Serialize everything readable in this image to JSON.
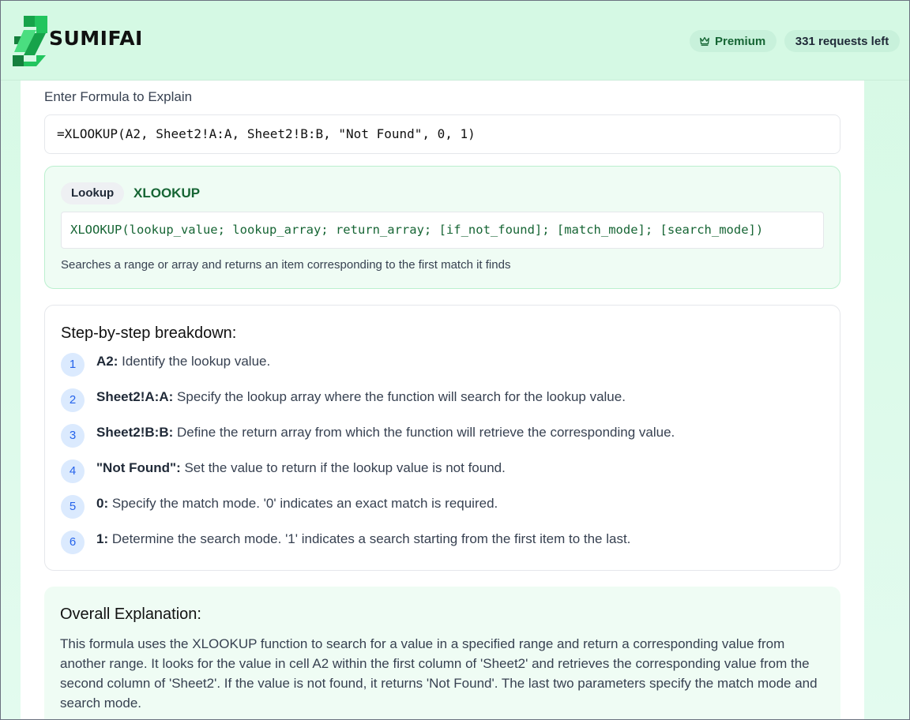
{
  "header": {
    "brand": "SUMIFAI",
    "premium_label": "Premium",
    "requests_label": "331 requests left",
    "colors": {
      "brand_green": "#16a34a",
      "header_bg": "#d5f9e4"
    }
  },
  "formula": {
    "label": "Enter Formula to Explain",
    "value": "=XLOOKUP(A2, Sheet2!A:A, Sheet2!B:B, \"Not Found\", 0, 1)"
  },
  "function_card": {
    "category": "Lookup",
    "name": "XLOOKUP",
    "syntax": "XLOOKUP(lookup_value; lookup_array; return_array; [if_not_found]; [match_mode]; [search_mode])",
    "description": "Searches a range or array and returns an item corresponding to the first match it finds"
  },
  "breakdown": {
    "title": "Step-by-step breakdown:",
    "steps": [
      {
        "num": "1",
        "term": "A2:",
        "text": " Identify the lookup value."
      },
      {
        "num": "2",
        "term": "Sheet2!A:A:",
        "text": " Specify the lookup array where the function will search for the lookup value."
      },
      {
        "num": "3",
        "term": "Sheet2!B:B:",
        "text": " Define the return array from which the function will retrieve the corresponding value."
      },
      {
        "num": "4",
        "term": "\"Not Found\":",
        "text": " Set the value to return if the lookup value is not found."
      },
      {
        "num": "5",
        "term": "0:",
        "text": " Specify the match mode. '0' indicates an exact match is required."
      },
      {
        "num": "6",
        "term": "1:",
        "text": " Determine the search mode. '1' indicates a search starting from the first item to the last."
      }
    ]
  },
  "overall": {
    "title": "Overall Explanation:",
    "text": "This formula uses the XLOOKUP function to search for a value in a specified range and return a corresponding value from another range. It looks for the value in cell A2 within the first column of 'Sheet2' and retrieves the corresponding value from the second column of 'Sheet2'. If the value is not found, it returns 'Not Found'. The last two parameters specify the match mode and search mode."
  }
}
